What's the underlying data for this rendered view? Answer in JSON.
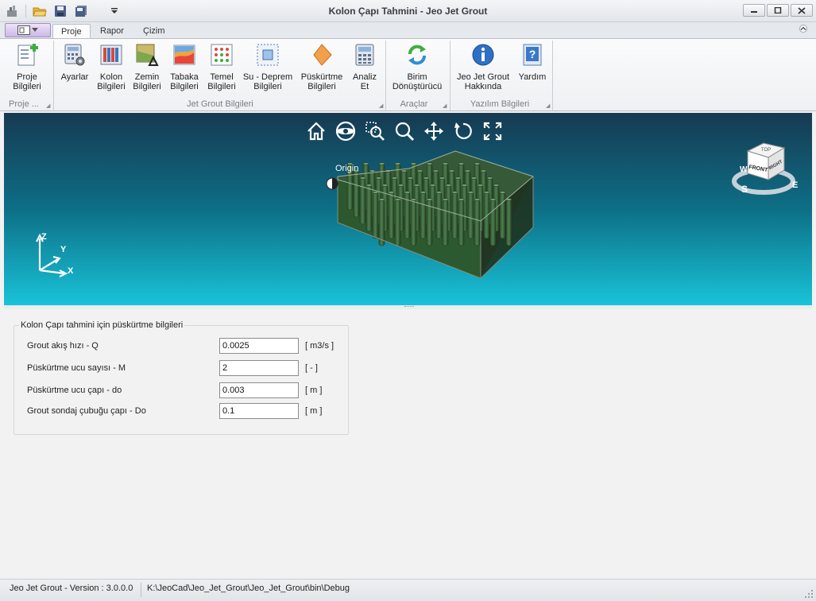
{
  "window": {
    "title": "Kolon Çapı Tahmini - Jeo Jet Grout"
  },
  "quick_access": {
    "icons": [
      "app-icon",
      "open-folder-icon",
      "save-icon",
      "save-all-icon",
      "customize-dropdown-icon"
    ]
  },
  "ribbon": {
    "tabs": [
      {
        "label": "Proje",
        "active": true
      },
      {
        "label": "Rapor",
        "active": false
      },
      {
        "label": "Çizim",
        "active": false
      }
    ],
    "groups": {
      "proje": {
        "label": "Proje ...",
        "buttons": [
          {
            "label": "Proje\nBilgileri",
            "icon": "project-info-icon"
          }
        ]
      },
      "jet_grout": {
        "label": "Jet Grout Bilgileri",
        "buttons": [
          {
            "label": "Ayarlar",
            "icon": "settings-icon"
          },
          {
            "label": "Kolon\nBilgileri",
            "icon": "column-info-icon"
          },
          {
            "label": "Zemin\nBilgileri",
            "icon": "soil-info-icon"
          },
          {
            "label": "Tabaka\nBilgileri",
            "icon": "layer-info-icon"
          },
          {
            "label": "Temel\nBilgileri",
            "icon": "foundation-info-icon"
          },
          {
            "label": "Su - Deprem\nBilgileri",
            "icon": "water-earthquake-icon"
          },
          {
            "label": "Püskürtme\nBilgileri",
            "icon": "spray-info-icon"
          },
          {
            "label": "Analiz\nEt",
            "icon": "analyze-icon"
          }
        ]
      },
      "araclar": {
        "label": "Araçlar",
        "buttons": [
          {
            "label": "Birim\nDönüştürücü",
            "icon": "unit-converter-icon"
          }
        ]
      },
      "yazilim": {
        "label": "Yazılım Bilgileri",
        "buttons": [
          {
            "label": "Jeo Jet Grout\nHakkında",
            "icon": "about-icon"
          },
          {
            "label": "Yardım",
            "icon": "help-icon"
          }
        ]
      }
    }
  },
  "viewport": {
    "tools": [
      "home-icon",
      "orbit-icon",
      "zoom-window-icon",
      "zoom-icon",
      "pan-icon",
      "rotate-icon",
      "fullscreen-icon"
    ],
    "origin_label": "Origin",
    "axes": {
      "x": "X",
      "y": "Y",
      "z": "Z"
    },
    "viewcube": {
      "faces": [
        "TOP",
        "FRONT",
        "RIGHT"
      ],
      "compass": [
        "W",
        "S",
        "E"
      ]
    },
    "colors": {
      "bg_top": "#163a52",
      "bg_bottom": "#18c3d8",
      "columns": "#3c6b3c"
    }
  },
  "form": {
    "title": "Kolon Çapı tahmini için püskürtme bilgileri",
    "fields": [
      {
        "label": "Grout akış hızı - Q",
        "value": "0.0025",
        "unit": "[ m3/s ]"
      },
      {
        "label": "Püskürtme ucu sayısı - M",
        "value": "2",
        "unit": "[ - ]"
      },
      {
        "label": "Püskürtme ucu çapı - do",
        "value": "0.003",
        "unit": "[ m ]"
      },
      {
        "label": "Grout sondaj çubuğu çapı - Do",
        "value": "0.1",
        "unit": "[ m ]"
      }
    ]
  },
  "statusbar": {
    "version": "Jeo Jet Grout - Version : 3.0.0.0",
    "path": "K:\\JeoCad\\Jeo_Jet_Grout\\Jeo_Jet_Grout\\bin\\Debug"
  }
}
